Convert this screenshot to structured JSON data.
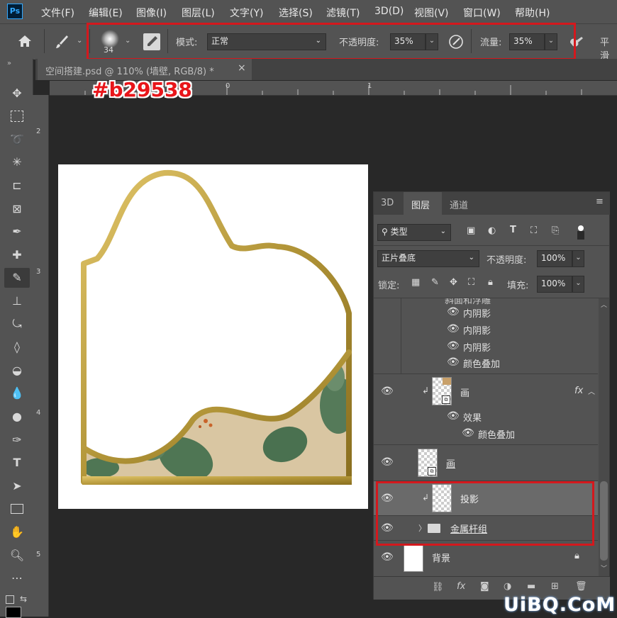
{
  "app": {
    "logo": "Ps"
  },
  "menu": [
    "文件(F)",
    "编辑(E)",
    "图像(I)",
    "图层(L)",
    "文字(Y)",
    "选择(S)",
    "滤镜(T)",
    "3D(D)",
    "视图(V)",
    "窗口(W)",
    "帮助(H)"
  ],
  "options": {
    "brush_size": "34",
    "mode_label": "模式:",
    "mode_value": "正常",
    "opacity_label": "不透明度:",
    "opacity_value": "35%",
    "flow_label": "流量:",
    "flow_value": "35%",
    "smooth_label": "平滑"
  },
  "document_tab": {
    "title": "空间搭建.psd @ 110% (墙壁, RGB/8) *",
    "close": "×"
  },
  "annotation": {
    "color_hex": "#b29538",
    "highlight_color": "#d4181d"
  },
  "ruler_top": [
    "0",
    "1"
  ],
  "ruler_left": [
    "2",
    "3",
    "4",
    "5"
  ],
  "layers_panel": {
    "tabs": [
      "3D",
      "图层",
      "通道"
    ],
    "active_tab": "图层",
    "filter_kind": "类型",
    "blend_mode": "正片叠底",
    "opacity_label": "不透明度:",
    "opacity_value": "100%",
    "lock_label": "锁定:",
    "fill_label": "填充:",
    "fill_value": "100%",
    "effects_top": [
      "内阴影",
      "内阴影",
      "内阴影",
      "颜色叠加"
    ],
    "layer_hua_fx": {
      "name": "画",
      "fx": "fx",
      "effects_label": "效果",
      "effect": "颜色叠加"
    },
    "layer_hua": {
      "name": "画"
    },
    "layer_shadow": {
      "name": "投影"
    },
    "group_metal": {
      "name": "金属杆组"
    },
    "layer_bg": {
      "name": "背景"
    }
  },
  "watermark": "UiBQ.CoM"
}
